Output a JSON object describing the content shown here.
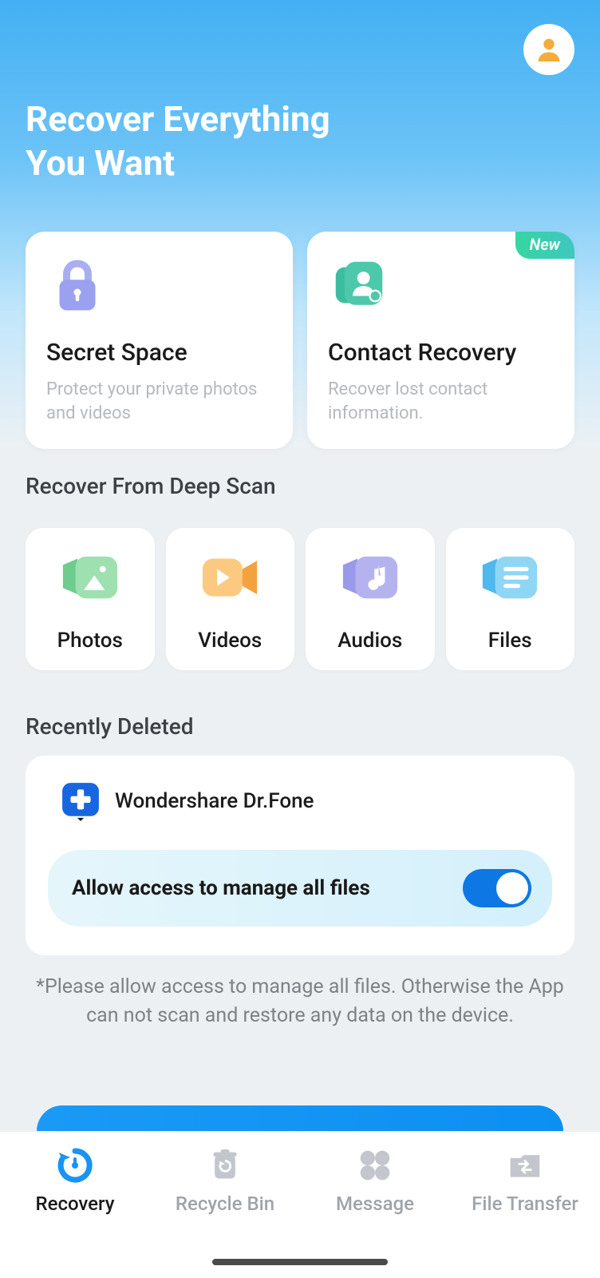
{
  "header": {
    "title": "Recover Everything\nYou Want"
  },
  "features": [
    {
      "title": "Secret Space",
      "desc": "Protect your private photos and videos",
      "badge": null
    },
    {
      "title": "Contact Recovery",
      "desc": "Recover lost contact information.",
      "badge": "New"
    }
  ],
  "deepScan": {
    "heading": "Recover From Deep Scan",
    "items": [
      "Photos",
      "Videos",
      "Audios",
      "Files"
    ]
  },
  "recent": {
    "heading": "Recently Deleted",
    "appName": "Wondershare Dr.Fone",
    "permissionLabel": "Allow access to manage all files",
    "toggleOn": true
  },
  "note": "*Please allow access to manage all files. Otherwise the App can not scan and restore any data on the device.",
  "nav": {
    "items": [
      "Recovery",
      "Recycle Bin",
      "Message",
      "File Transfer"
    ],
    "activeIndex": 0
  }
}
